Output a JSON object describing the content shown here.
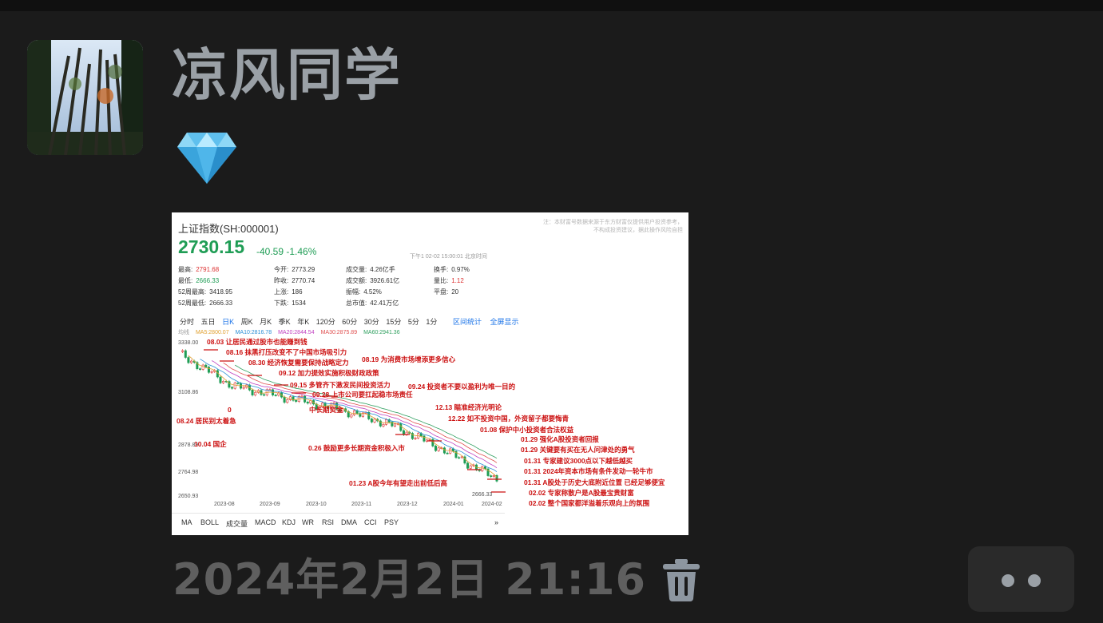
{
  "post": {
    "username": "凉风同学",
    "timestamp": "2024年2月2日 21:16",
    "badge_icon": "diamond-icon",
    "avatar": "tree-canopy-avatar"
  },
  "stock": {
    "name": "上证指数(SH:000001)",
    "price": "2730.15",
    "change": "-40.59 -1.46%",
    "time_line": "下午1 02-02 15:00:01 北京时间",
    "notice": "注：本财富号数据来源于东方财富仅提供用户投资参考，不构成投资建议，据此操作风险自担",
    "stats": [
      {
        "label": "最高:",
        "value": "2791.68",
        "tone": "up"
      },
      {
        "label": "今开:",
        "value": "2773.29",
        "tone": ""
      },
      {
        "label": "成交量:",
        "value": "4.26亿手",
        "tone": ""
      },
      {
        "label": "换手:",
        "value": "0.97%",
        "tone": ""
      },
      {
        "label": "最低:",
        "value": "2666.33",
        "tone": "dn"
      },
      {
        "label": "昨收:",
        "value": "2770.74",
        "tone": ""
      },
      {
        "label": "成交额:",
        "value": "3926.61亿",
        "tone": ""
      },
      {
        "label": "量比:",
        "value": "1.12",
        "tone": "up"
      },
      {
        "label": "52周最高:",
        "value": "3418.95",
        "tone": ""
      },
      {
        "label": "上涨:",
        "value": "186",
        "tone": ""
      },
      {
        "label": "振幅:",
        "value": "4.52%",
        "tone": ""
      },
      {
        "label": "平盘:",
        "value": "20",
        "tone": ""
      },
      {
        "label": "52周最低:",
        "value": "2666.33",
        "tone": ""
      },
      {
        "label": "下跌:",
        "value": "1534",
        "tone": ""
      },
      {
        "label": "总市值:",
        "value": "42.41万亿",
        "tone": ""
      }
    ],
    "periods": [
      "分时",
      "五日",
      "日K",
      "周K",
      "月K",
      "季K",
      "年K",
      "120分",
      "60分",
      "30分",
      "15分",
      "5分",
      "1分"
    ],
    "active_period": "日K",
    "ranges": [
      "区间统计",
      "全屏显示"
    ],
    "ma_legend": [
      {
        "label": "均线",
        "color": "#888888"
      },
      {
        "label": "MA5:2800.07",
        "color": "#e0a030"
      },
      {
        "label": "MA10:2816.78",
        "color": "#2b8fd6"
      },
      {
        "label": "MA20:2844.54",
        "color": "#c040c0"
      },
      {
        "label": "MA30:2875.89",
        "color": "#e05050"
      },
      {
        "label": "MA60:2941.36",
        "color": "#30a060"
      }
    ],
    "y_ticks": [
      "3338.00",
      "3108.86",
      "2878.89",
      "2764.98",
      "2650.93"
    ],
    "x_ticks": [
      "2023-08",
      "2023-09",
      "2023-10",
      "2023-11",
      "2023-12",
      "2024-01",
      "2024-02"
    ],
    "low_label": "2666.33",
    "indicators": [
      "MA",
      "BOLL",
      "成交量",
      "MACD",
      "KDJ",
      "WR",
      "RSI",
      "DMA",
      "CCI",
      "PSY",
      "»"
    ]
  },
  "chart_data": {
    "type": "line",
    "title": "上证指数(SH:000001)",
    "x": [
      "2023-08",
      "2023-09",
      "2023-10",
      "2023-11",
      "2023-12",
      "2024-01",
      "2024-02"
    ],
    "series": [
      {
        "name": "",
        "values": [
          3280,
          3140,
          3090,
          3040,
          2970,
          2860,
          2730
        ]
      }
    ],
    "ylim": [
      2650,
      3340
    ],
    "annotations": [
      "08.03 让居民通过股市也能赚到钱",
      "08.16 抹黑打压改变不了中国市场吸引力",
      "08.19 为消费市场增添更多信心",
      "08.30 经济恢复需要保持战略定力",
      "09.12 加力提效实施积极财政政策",
      "09.15 多管齐下激发民间投资活力",
      "09.24 投资者不要以盈利为唯一目的",
      "09.28 上市公司要扛起稳市场责任",
      "08.24 居民别太着急",
      "10.04 国企",
      "中长期资金",
      "12.13 瞄准经济光明论",
      "12.22 如不投资中国，外资留子都要悔青",
      "01.08 保护中小投资者合法权益",
      "01.29 强化A股投资者回报",
      "01.29 关键要有买在无人问津处的勇气",
      "01.31 专家建议3000点以下越低越买",
      "01.31 2024年资本市场有条件发动一轮牛市",
      "01.31 A股处于历史大底附近位置 已经足够便宜",
      "02.02 专家称散户是A股最宝贵财富",
      "02.02 整个国家都洋溢着乐观向上的氛围",
      "0.26 鼓励更多长期资金积极入市",
      "01.23 A股今年有望走出前低后高",
      "0"
    ]
  }
}
